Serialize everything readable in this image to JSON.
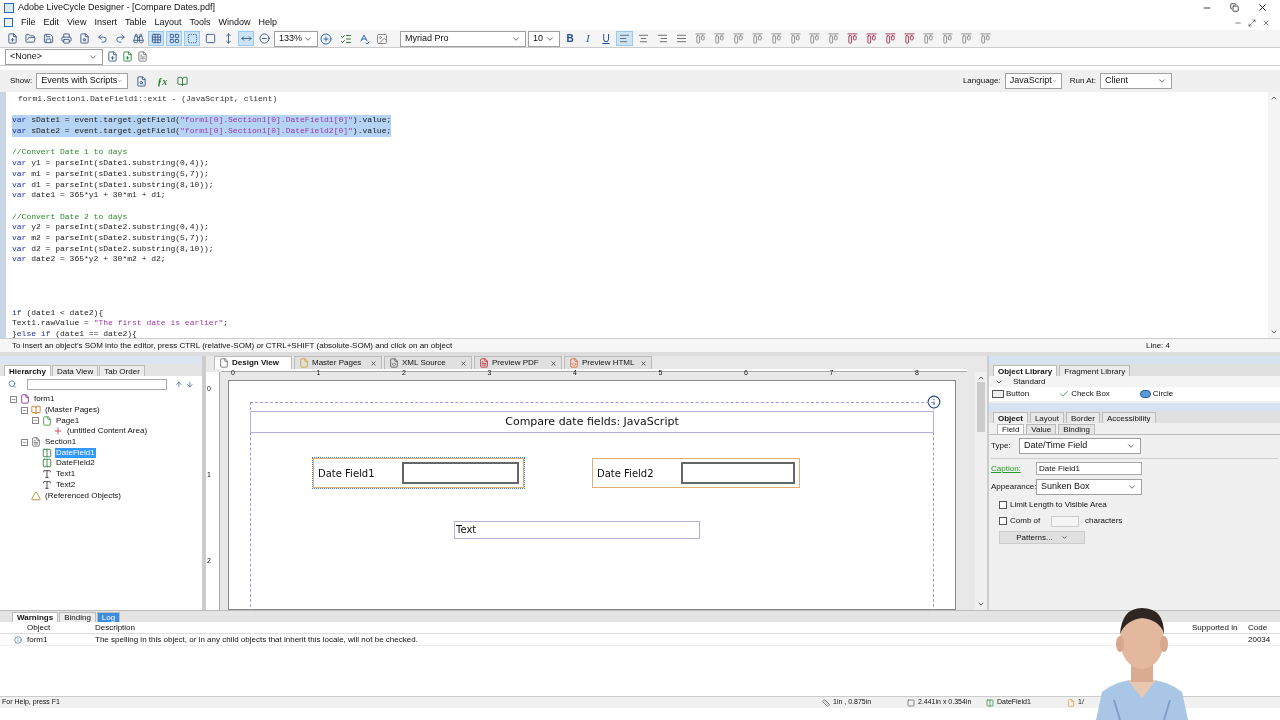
{
  "window": {
    "title": "Adobe LiveCycle Designer - [Compare Dates.pdf]"
  },
  "menu": [
    "File",
    "Edit",
    "View",
    "Insert",
    "Table",
    "Layout",
    "Tools",
    "Window",
    "Help"
  ],
  "toolbar": {
    "left": [
      {
        "pressed": false
      },
      {
        "pressed": false
      },
      {
        "pressed": false
      },
      {
        "pressed": false
      },
      {
        "pressed": false
      },
      {
        "pressed": false
      },
      {
        "pressed": false
      },
      {
        "pressed": false
      },
      {
        "pressed": true
      },
      {
        "pressed": true
      },
      {
        "pressed": true
      },
      {
        "pressed": false
      },
      {
        "pressed": false
      },
      {
        "pressed": true
      },
      {
        "pressed": false
      }
    ],
    "zoom": "133%",
    "font": "Myriad Pro",
    "size": "10",
    "format": [
      {
        "label": "B",
        "pressed": false
      },
      {
        "label": "I",
        "pressed": false
      },
      {
        "label": "U",
        "pressed": false
      }
    ],
    "align": [
      {
        "pressed": true
      },
      {
        "pressed": false
      },
      {
        "pressed": false
      },
      {
        "pressed": false
      }
    ]
  },
  "style_combo": "<None>",
  "script_bar": {
    "show_label": "Show:",
    "show": "Events with Scripts",
    "function_icon": "ƒx",
    "language_label": "Language:",
    "language": "JavaScript",
    "run_at_label": "Run At:",
    "run_at": "Client"
  },
  "editor": {
    "lines": [
      {
        "kind": "header",
        "text": "form1.Section1.DateField1::exit - (JavaScript, client)"
      },
      {
        "kind": "blank"
      },
      {
        "kind": "code",
        "text": "var sDate1 = event.target.getField(\"form1[0].Section1[0].DateField1[0]\").value;",
        "selected": true
      },
      {
        "kind": "code",
        "text": "var sDate2 = event.target.getField(\"form1[0].Section1[0].DateField2[0]\").value;",
        "selected": true
      },
      {
        "kind": "blank"
      },
      {
        "kind": "comment",
        "text": "//Convert Date 1 to days"
      },
      {
        "kind": "code",
        "text": "var y1 = parseInt(sDate1.substring(0,4));",
        "selected": false
      },
      {
        "kind": "code",
        "text": "var m1 = parseInt(sDate1.substring(5,7));",
        "selected": false
      },
      {
        "kind": "code",
        "text": "var d1 = parseInt(sDate1.substring(8,10));",
        "selected": false
      },
      {
        "kind": "code",
        "text": "var date1 = 365*y1 + 30*m1 + d1;",
        "selected": false
      },
      {
        "kind": "blank"
      },
      {
        "kind": "comment",
        "text": "//Convert Date 2 to days"
      },
      {
        "kind": "code",
        "text": "var y2 = parseInt(sDate2.substring(0,4));",
        "selected": false
      },
      {
        "kind": "code",
        "text": "var m2 = parseInt(sDate2.substring(5,7));",
        "selected": false
      },
      {
        "kind": "code",
        "text": "var d2 = parseInt(sDate2.substring(8,10));",
        "selected": false
      },
      {
        "kind": "code",
        "text": "var date2 = 365*y2 + 30*m2 + d2;",
        "selected": false
      },
      {
        "kind": "blank"
      },
      {
        "kind": "blank"
      },
      {
        "kind": "blank"
      },
      {
        "kind": "blank"
      },
      {
        "kind": "code",
        "text": "if (date1 < date2){",
        "selected": false
      },
      {
        "kind": "code",
        "text": "Text1.rawValue = \"The first date is earlier\";",
        "selected": false
      },
      {
        "kind": "code",
        "text": "}else if (date1 == date2){",
        "selected": false
      }
    ],
    "hint": "To insert an object's SOM into the editor, press CTRL (relative-SOM) or CTRL+SHIFT (absolute-SOM) and click on an object",
    "line_status": "Line: 4"
  },
  "hierarchy": {
    "tabs": [
      {
        "label": "Hierarchy",
        "selected": true
      },
      {
        "label": "Data View",
        "selected": false
      },
      {
        "label": "Tab Order",
        "selected": false
      }
    ],
    "tree": [
      {
        "label": "form1",
        "kind": "form",
        "expanded": true,
        "selected": false,
        "children": [
          {
            "label": "(Master Pages)",
            "kind": "master",
            "expanded": true,
            "selected": false,
            "children": [
              {
                "label": "Page1",
                "kind": "page",
                "expanded": true,
                "selected": false,
                "children": [
                  {
                    "label": "(untitled Content Area)",
                    "kind": "content",
                    "selected": false
                  }
                ]
              }
            ]
          },
          {
            "label": "Section1",
            "kind": "section",
            "expanded": true,
            "selected": false,
            "children": [
              {
                "label": "DateField1",
                "kind": "datefield",
                "selected": true
              },
              {
                "label": "DateField2",
                "kind": "datefield",
                "selected": false
              },
              {
                "label": "Text1",
                "kind": "text",
                "selected": false
              },
              {
                "label": "Text2",
                "kind": "text",
                "selected": false
              }
            ]
          },
          {
            "label": "(Referenced Objects)",
            "kind": "referenced",
            "selected": false
          }
        ]
      }
    ]
  },
  "design": {
    "tabs": [
      {
        "label": "Design View",
        "kind": "page",
        "selected": true
      },
      {
        "label": "Master Pages",
        "kind": "master",
        "selected": false
      },
      {
        "label": "XML Source",
        "kind": "xml",
        "selected": false
      },
      {
        "label": "Preview PDF",
        "kind": "pdf",
        "selected": false
      },
      {
        "label": "Preview HTML",
        "kind": "html",
        "selected": false
      }
    ],
    "ruler": [
      "0",
      "1",
      "2",
      "3",
      "4",
      "5",
      "6",
      "7",
      "8"
    ],
    "vruler": [
      "0",
      "1",
      "2"
    ],
    "title": "Compare date fields: JavaScript",
    "fields": [
      {
        "caption": "Date Field1",
        "selected": true
      },
      {
        "caption": "Date Field2",
        "selected": false
      }
    ],
    "text_object": "Text"
  },
  "object_library": {
    "tabs": [
      {
        "label": "Object Library",
        "selected": true
      },
      {
        "label": "Fragment Library",
        "selected": false
      }
    ],
    "group": "Standard",
    "items": [
      {
        "label": "Button",
        "kind": "button"
      },
      {
        "label": "Check Box",
        "kind": "checkbox"
      },
      {
        "label": "Circle",
        "kind": "circle"
      }
    ]
  },
  "object_panel": {
    "tabs": [
      {
        "label": "Object",
        "selected": true
      },
      {
        "label": "Layout",
        "selected": false
      },
      {
        "label": "Border",
        "selected": false
      },
      {
        "label": "Accessibility",
        "selected": false
      }
    ],
    "subtabs": [
      {
        "label": "Field",
        "selected": true
      },
      {
        "label": "Value",
        "selected": false
      },
      {
        "label": "Binding",
        "selected": false
      }
    ],
    "type_label": "Type:",
    "type": "Date/Time Field",
    "caption_label": "Caption:",
    "caption": "Date Field1",
    "appearance_label": "Appearance:",
    "appearance": "Sunken Box",
    "limit": {
      "label": "Limit Length to Visible Area",
      "checked": false
    },
    "comb": {
      "label": "Comb of",
      "checked": false,
      "suffix": "characters"
    },
    "patterns": "Patterns..."
  },
  "report": {
    "tabs": [
      {
        "label": "Warnings",
        "selected": true,
        "highlighted": false
      },
      {
        "label": "Binding",
        "selected": false,
        "highlighted": false
      },
      {
        "label": "Log",
        "selected": false,
        "highlighted": true
      }
    ],
    "columns": [
      "Object",
      "Description",
      "Supported in",
      "Code"
    ],
    "rows": [
      {
        "object": "form1",
        "description": "The spelling in this object, or in any child objects that inherit this locale, will not be checked.",
        "code": "20034"
      }
    ]
  },
  "status_bar": {
    "help": "For Help, press F1",
    "position": "1in , 0.875in",
    "size": "2.441in x 0.354in",
    "object": "DateField1",
    "page": "1/"
  }
}
